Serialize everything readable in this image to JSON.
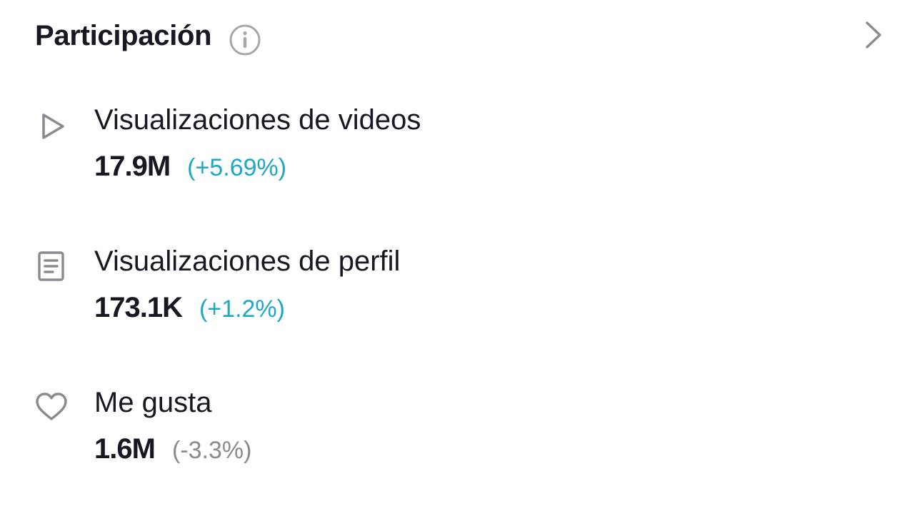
{
  "header": {
    "title": "Participación",
    "info_icon": "info-circle-icon",
    "chevron_icon": "chevron-right-icon"
  },
  "metrics": [
    {
      "icon": "play-icon",
      "label": "Visualizaciones de videos",
      "value": "17.9M",
      "change": "(+5.69%)",
      "trend": "up"
    },
    {
      "icon": "document-icon",
      "label": "Visualizaciones de perfil",
      "value": "173.1K",
      "change": "(+1.2%)",
      "trend": "up"
    },
    {
      "icon": "heart-icon",
      "label": "Me gusta",
      "value": "1.6M",
      "change": "(-3.3%)",
      "trend": "down"
    }
  ],
  "colors": {
    "text_primary": "#161823",
    "icon_gray": "#8a8b91",
    "change_up": "#20a7c2",
    "change_down": "#8a8b91"
  }
}
